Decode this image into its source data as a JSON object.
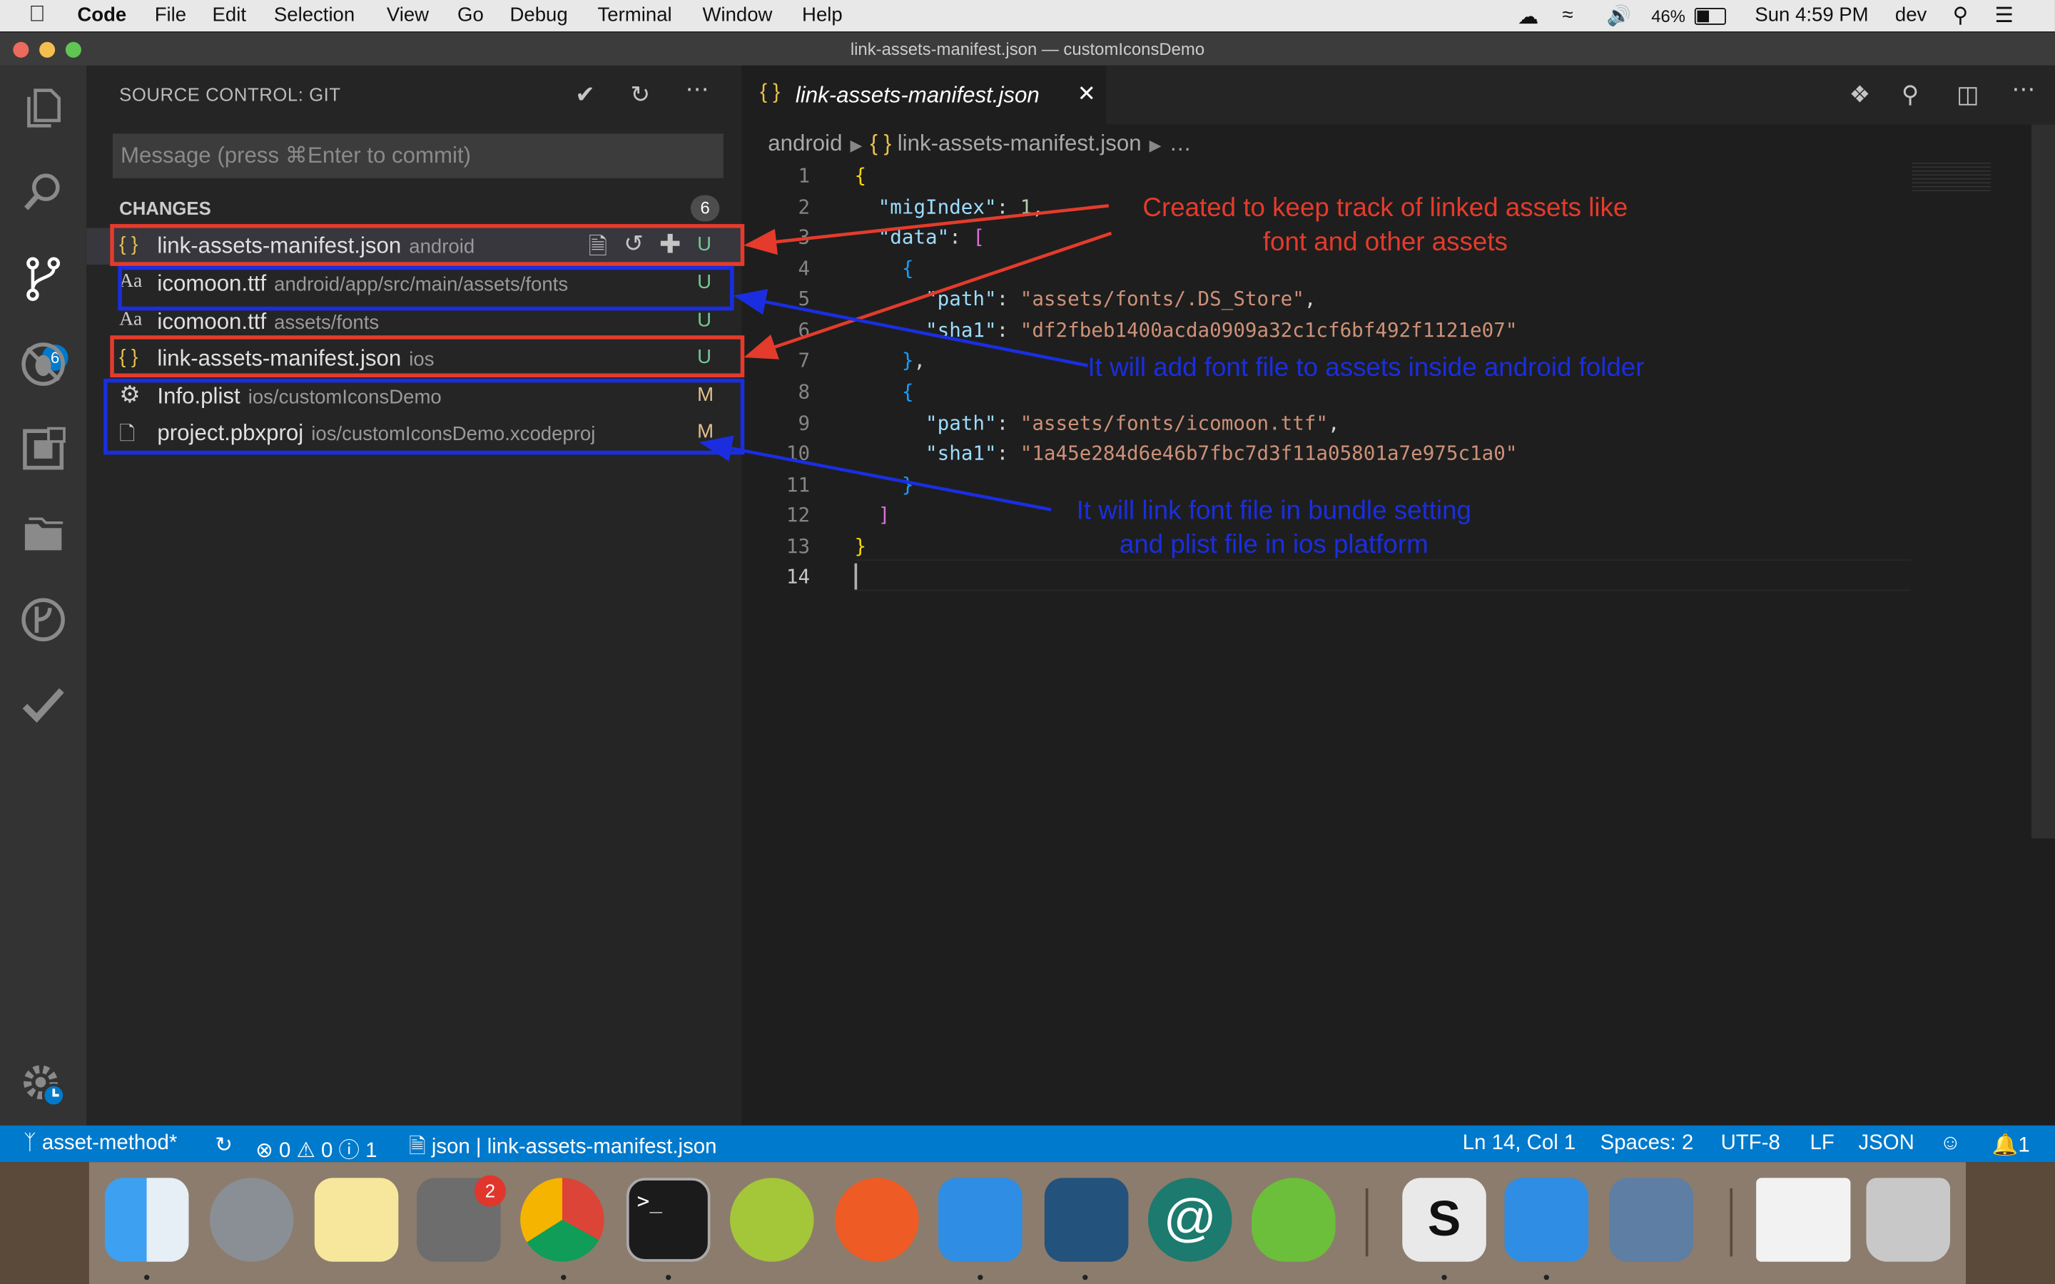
{
  "menubar": {
    "app_name": "Code",
    "items": [
      "File",
      "Edit",
      "Selection",
      "View",
      "Go",
      "Debug",
      "Terminal",
      "Window",
      "Help"
    ],
    "battery": "46%",
    "clock": "Sun 4:59 PM",
    "user": "dev"
  },
  "window": {
    "title": "link-assets-manifest.json — customIconsDemo"
  },
  "activity_bar": {
    "scm_badge": "6",
    "icons": [
      "files-icon",
      "search-icon",
      "source-control-icon",
      "debug-icon",
      "extensions-icon",
      "folder-icon",
      "git-lens-icon",
      "check-icon",
      "settings-gear-icon"
    ]
  },
  "sidebar": {
    "title": "SOURCE CONTROL: GIT",
    "commit_placeholder": "Message (press ⌘Enter to commit)",
    "changes_label": "CHANGES",
    "changes_count": "6",
    "files": [
      {
        "icon": "{ }",
        "name": "link-assets-manifest.json",
        "path": "android",
        "status": "U"
      },
      {
        "icon": "Aa",
        "name": "icomoon.ttf",
        "path": "android/app/src/main/assets/fonts",
        "status": "U"
      },
      {
        "icon": "Aa",
        "name": "icomoon.ttf",
        "path": "assets/fonts",
        "status": "U"
      },
      {
        "icon": "{ }",
        "name": "link-assets-manifest.json",
        "path": "ios",
        "status": "U"
      },
      {
        "icon": "⚙",
        "name": "Info.plist",
        "path": "ios/customIconsDemo",
        "status": "M"
      },
      {
        "icon": "🗋",
        "name": "project.pbxproj",
        "path": "ios/customIconsDemo.xcodeproj",
        "status": "M"
      }
    ]
  },
  "editor": {
    "tab_icon": "{ }",
    "tab_label": "link-assets-manifest.json",
    "breadcrumb": [
      "android",
      "{ }",
      "link-assets-manifest.json",
      "…"
    ],
    "line_numbers": [
      "1",
      "2",
      "3",
      "4",
      "5",
      "6",
      "7",
      "8",
      "9",
      "10",
      "11",
      "12",
      "13",
      "14"
    ],
    "code": {
      "key_migIndex": "\"migIndex\"",
      "val_migIndex": "1",
      "key_data": "\"data\"",
      "key_path": "\"path\"",
      "key_sha1": "\"sha1\"",
      "path1": "\"assets/fonts/.DS_Store\"",
      "sha1_1": "\"df2fbeb1400acda0909a32c1cf6bf492f1121e07\"",
      "path2": "\"assets/fonts/icomoon.ttf\"",
      "sha1_2": "\"1a45e284d6e46b7fbc7d3f11a05801a7e975c1a0\""
    }
  },
  "statusbar": {
    "branch": "asset-method*",
    "errors": "0",
    "warnings": "0",
    "infos": "1",
    "lang_file": "json | link-assets-manifest.json",
    "position": "Ln 14, Col 1",
    "spaces": "Spaces: 2",
    "encoding": "UTF-8",
    "eol": "LF",
    "language": "JSON",
    "notifications": "1"
  },
  "dock": {
    "prefs_badge": "2"
  },
  "annotations": {
    "red_note": "Created to keep track of linked assets like\nfont and other assets",
    "blue_note_android": "It will add font file to assets inside android folder",
    "blue_note_ios": "It will link font file in bundle setting\nand plist file in ios platform"
  },
  "colors": {
    "accent": "#007acc",
    "annotation_red": "#e43b2c",
    "annotation_blue": "#1a2ee0"
  }
}
